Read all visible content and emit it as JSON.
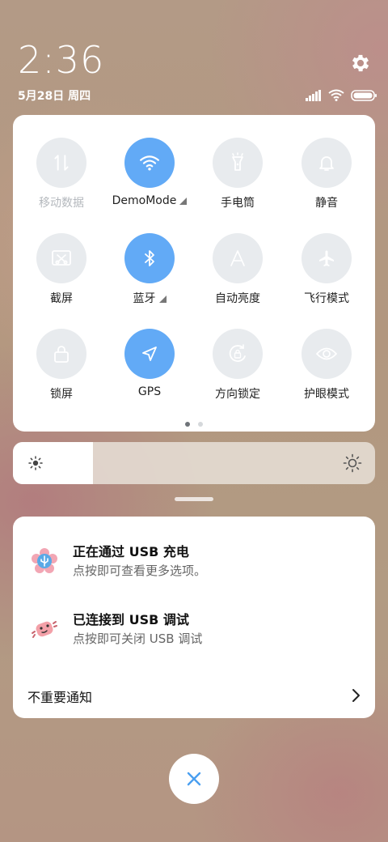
{
  "status": {
    "time": "2:36",
    "date": "5月28日 周四"
  },
  "quick_settings": {
    "tiles": [
      {
        "label": "移动数据",
        "state": "disabled",
        "icon": "mobile-data-icon"
      },
      {
        "label": "DemoMode",
        "state": "on",
        "icon": "wifi-icon",
        "has_arrow": true
      },
      {
        "label": "手电筒",
        "state": "off",
        "icon": "flashlight-icon"
      },
      {
        "label": "静音",
        "state": "off",
        "icon": "bell-icon"
      },
      {
        "label": "截屏",
        "state": "off",
        "icon": "screenshot-icon"
      },
      {
        "label": "蓝牙",
        "state": "on",
        "icon": "bluetooth-icon",
        "has_arrow": true
      },
      {
        "label": "自动亮度",
        "state": "off",
        "icon": "auto-brightness-icon"
      },
      {
        "label": "飞行模式",
        "state": "off",
        "icon": "airplane-icon"
      },
      {
        "label": "锁屏",
        "state": "off",
        "icon": "lock-icon"
      },
      {
        "label": "GPS",
        "state": "on",
        "icon": "location-arrow-icon"
      },
      {
        "label": "方向锁定",
        "state": "off",
        "icon": "rotation-lock-icon"
      },
      {
        "label": "护眼模式",
        "state": "off",
        "icon": "eye-icon"
      }
    ],
    "page_count": 2,
    "current_page": 1
  },
  "brightness": {
    "level": 0.22
  },
  "notifications": {
    "items": [
      {
        "title": "正在通过 USB 充电",
        "subtitle": "点按即可查看更多选项。",
        "icon": "usb-charging-icon"
      },
      {
        "title": "已连接到 USB 调试",
        "subtitle": "点按即可关闭 USB 调试",
        "icon": "usb-debug-icon"
      }
    ],
    "minor_label": "不重要通知"
  },
  "colors": {
    "accent": "#62aaf6",
    "tile_off": "#e8ebee"
  }
}
